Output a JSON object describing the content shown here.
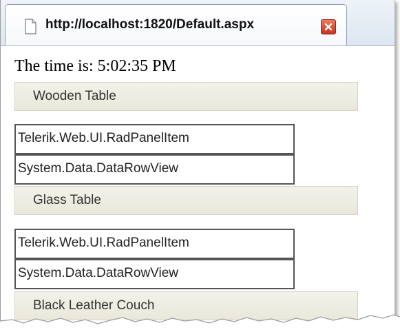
{
  "browser": {
    "tab_title": "http://localhost:1820/Default.aspx",
    "icons": {
      "page": "page-icon",
      "close": "close-icon"
    },
    "close_color": "#d9432a"
  },
  "page": {
    "time_text": "The time is: 5:02:35 PM",
    "panel": [
      {
        "header": "Wooden Table",
        "items": [
          "Telerik.Web.UI.RadPanelItem",
          "System.Data.DataRowView"
        ]
      },
      {
        "header": "Glass Table",
        "items": [
          "Telerik.Web.UI.RadPanelItem",
          "System.Data.DataRowView"
        ]
      },
      {
        "header": "Black Leather Couch",
        "items": []
      }
    ],
    "colors": {
      "panel_header_bg": "#efeee2",
      "item_border": "#555555"
    }
  }
}
